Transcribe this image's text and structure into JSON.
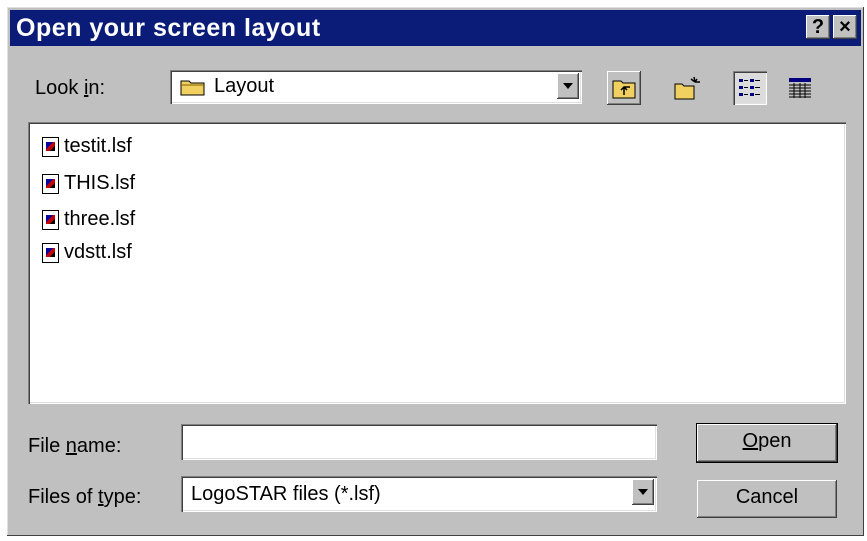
{
  "window": {
    "title": "Open your screen layout",
    "help_glyph": "?",
    "close_glyph": "×"
  },
  "look_in": {
    "label_pre": "Look ",
    "label_key": "i",
    "label_post": "n:",
    "value": "Layout"
  },
  "toolbar": {
    "up_icon": "up-folder-icon",
    "new_folder_icon": "new-folder-icon",
    "list_icon": "list-view-icon",
    "details_icon": "details-view-icon"
  },
  "files": [
    {
      "name": "testit.lsf"
    },
    {
      "name": "THIS.lsf"
    },
    {
      "name": "three.lsf"
    },
    {
      "name": "vdstt.lsf"
    }
  ],
  "file_name": {
    "label_pre": "File ",
    "label_key": "n",
    "label_post": "ame:",
    "value": ""
  },
  "file_type": {
    "label_pre": "Files of ",
    "label_key": "t",
    "label_post": "ype:",
    "value": "LogoSTAR files (*.lsf)"
  },
  "buttons": {
    "open_key": "O",
    "open_rest": "pen",
    "cancel": "Cancel"
  }
}
